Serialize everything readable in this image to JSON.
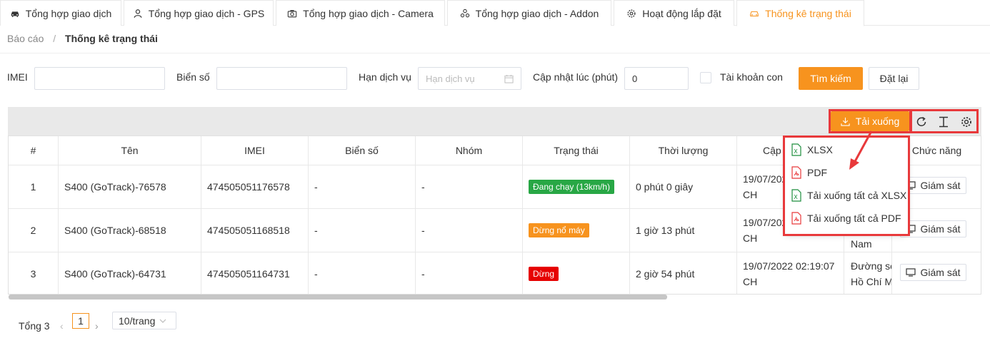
{
  "tabs": [
    {
      "label": "Tổng hợp giao dịch",
      "icon": "car-icon"
    },
    {
      "label": "Tổng hợp giao dịch - GPS",
      "icon": "user-icon"
    },
    {
      "label": "Tổng hợp giao dịch - Camera",
      "icon": "camera-icon"
    },
    {
      "label": "Tổng hợp giao dịch - Addon",
      "icon": "addon-icon"
    },
    {
      "label": "Hoạt động lắp đặt",
      "icon": "gear-icon"
    },
    {
      "label": "Thống kê trạng thái",
      "icon": "car-icon",
      "active": true
    }
  ],
  "breadcrumb": {
    "parent": "Báo cáo",
    "separator": "/",
    "current": "Thống kê trạng thái"
  },
  "filters": {
    "imei_label": "IMEI",
    "plate_label": "Biển số",
    "service_label": "Hạn dịch vụ",
    "service_placeholder": "Hạn dịch vụ",
    "update_label": "Cập nhật lúc (phút)",
    "update_value": "0",
    "subaccount_label": "Tài khoản con",
    "search_button": "Tìm kiếm",
    "reset_button": "Đặt lại"
  },
  "toolbar": {
    "download_label": "Tải xuống"
  },
  "download_menu": {
    "items": [
      "XLSX",
      "PDF",
      "Tải xuống tất cả XLSX",
      "Tải xuống tất cả PDF"
    ]
  },
  "table": {
    "headers": [
      "#",
      "Tên",
      "IMEI",
      "Biển số",
      "Nhóm",
      "Trạng thái",
      "Thời lượng",
      "Cập",
      "",
      "Chức năng"
    ],
    "rows": [
      {
        "index": "1",
        "name": "S400 (GoTrack)-76578",
        "imei": "474505051176578",
        "plate": "-",
        "group": "-",
        "status": "Đang chạy (13km/h)",
        "status_color": "#28a745",
        "duration": "0 phút 0 giây",
        "updated_line1": "19/07/202",
        "updated_line2": "CH",
        "address_line1": "",
        "address_line2": "",
        "action": "Giám sát"
      },
      {
        "index": "2",
        "name": "S400 (GoTrack)-68518",
        "imei": "474505051168518",
        "plate": "-",
        "group": "-",
        "status": "Dừng nổ máy",
        "status_color": "#f7931e",
        "duration": "1 giờ 13 phút",
        "updated_line1": "19/07/202",
        "updated_line2": "CH",
        "address_line1": "",
        "address_line2": "Việt Nam",
        "action": "Giám sát"
      },
      {
        "index": "3",
        "name": "S400 (GoTrack)-64731",
        "imei": "474505051164731",
        "plate": "-",
        "group": "-",
        "status": "Dừng",
        "status_color": "#e60000",
        "duration": "2 giờ 54 phút",
        "updated_line1": "19/07/2022 02:19:07",
        "updated_line2": "CH",
        "address_line1": "Đường số",
        "address_line2": "Hồ Chí M",
        "action": "Giám sát"
      }
    ]
  },
  "pagination": {
    "total_label": "Tổng 3",
    "current_page": "1",
    "page_size": "10/trang"
  },
  "colors": {
    "accent": "#f7931e",
    "highlight": "#e8393b"
  }
}
